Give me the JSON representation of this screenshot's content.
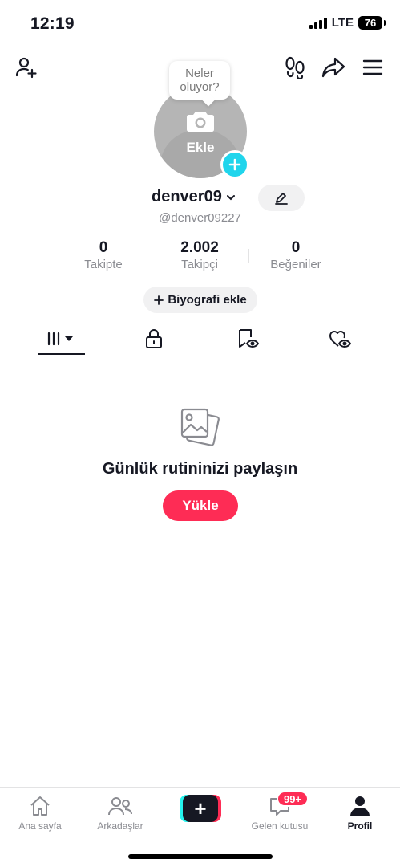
{
  "status_bar": {
    "time": "12:19",
    "network": "LTE",
    "battery": "76"
  },
  "header": {
    "icons": [
      "add-friend-icon",
      "footprints-icon",
      "share-icon",
      "menu-icon"
    ]
  },
  "profile": {
    "bubble_text_line1": "Neler",
    "bubble_text_line2": "oluyor?",
    "avatar_label": "Ekle",
    "username": "denver09",
    "handle": "@denver09227",
    "edit_icon": "pencil-icon"
  },
  "stats": [
    {
      "value": "0",
      "label": "Takipte"
    },
    {
      "value": "2.002",
      "label": "Takipçi"
    },
    {
      "value": "0",
      "label": "Beğeniler"
    }
  ],
  "bio_button": {
    "label": "Biyografi ekle"
  },
  "tabs": [
    {
      "icon": "grid-icon",
      "active": true
    },
    {
      "icon": "lock-icon",
      "active": false
    },
    {
      "icon": "bookmark-icon",
      "active": false
    },
    {
      "icon": "liked-icon",
      "active": false
    }
  ],
  "empty_state": {
    "title": "Günlük rutininizi paylaşın",
    "button": "Yükle"
  },
  "bottom_nav": {
    "home": "Ana sayfa",
    "friends": "Arkadaşlar",
    "inbox": "Gelen kutusu",
    "inbox_badge": "99+",
    "profile": "Profil"
  },
  "colors": {
    "accent": "#fe2c55",
    "cyan": "#20d5ec",
    "text": "#161823",
    "muted": "#8a8b91"
  }
}
